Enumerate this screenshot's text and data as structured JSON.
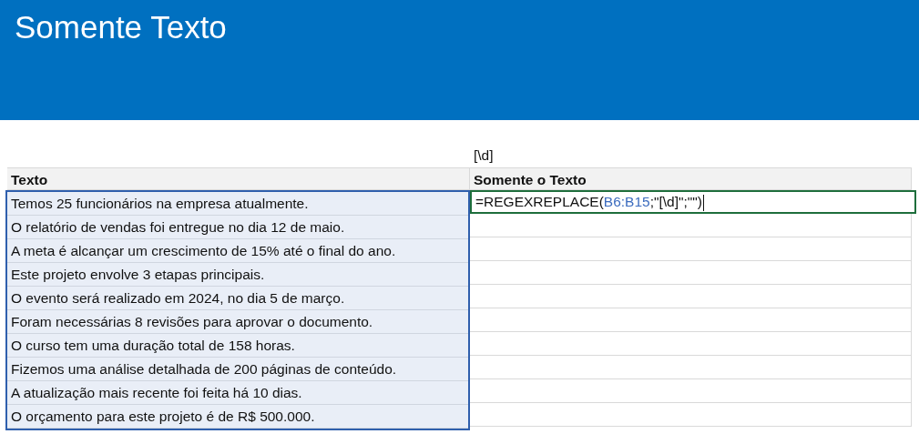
{
  "banner": {
    "title": "Somente Texto"
  },
  "pattern_note": "[\\d]",
  "table": {
    "columns": [
      "Texto",
      "Somente o Texto"
    ],
    "rows": [
      {
        "text": "Temos 25 funcionários na empresa atualmente.",
        "selected": true
      },
      {
        "text": "O relatório de vendas foi entregue no dia 12 de maio.",
        "selected": true
      },
      {
        "text": "A meta é alcançar um crescimento de 15% até o final do ano.",
        "selected": true
      },
      {
        "text": "Este projeto envolve 3 etapas principais.",
        "selected": true
      },
      {
        "text": "O evento será realizado em 2024, no dia 5 de março.",
        "selected": true
      },
      {
        "text": "Foram necessárias 8 revisões para aprovar o documento.",
        "selected": true
      },
      {
        "text": "O curso tem uma duração total de 158 horas.",
        "selected": true
      },
      {
        "text": "Fizemos uma análise detalhada de 200 páginas de conteúdo.",
        "selected": true
      },
      {
        "text": "A atualização mais recente foi feita há 10 dias.",
        "selected": true
      },
      {
        "text": "O orçamento para este projeto é de R$ 500.000.",
        "selected": true
      }
    ],
    "formula": {
      "before": "=REGEXREPLACE(",
      "reference": "B6:B15",
      "after": ";\"[\\d]\";\"\")",
      "active": true
    }
  }
}
